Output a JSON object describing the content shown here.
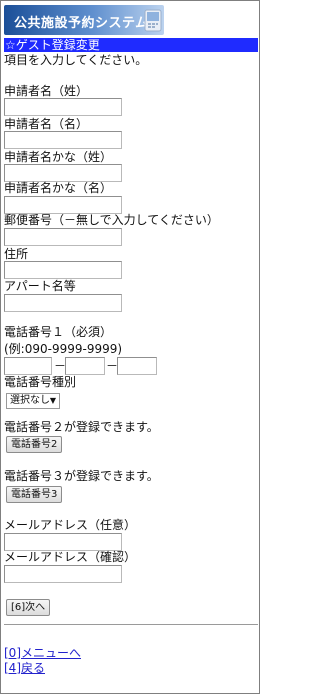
{
  "header": {
    "title": "公共施設予約システム"
  },
  "page_title": "☆ゲスト登録変更",
  "instruction": "項目を入力してください。",
  "fields": {
    "applicant_last": "申請者名（姓）",
    "applicant_first": "申請者名（名）",
    "applicant_kana_last": "申請者名かな（姓）",
    "applicant_kana_first": "申請者名かな（名）",
    "postal": "郵便番号（－無しで入力してください）",
    "address": "住所",
    "apartment": "アパート名等",
    "phone1": "電話番号１（必須）",
    "phone1_example": "(例:090-9999-9999)",
    "phone_separator": "－",
    "phone_type": "電話番号種別",
    "phone_type_value": "選択なし",
    "phone2_note": "電話番号２が登録できます。",
    "phone2_button": "電話番号2",
    "phone3_note": "電話番号３が登録できます。",
    "phone3_button": "電話番号3",
    "email_optional": "メールアドレス（任意）",
    "email_confirm": "メールアドレス（確認）"
  },
  "next_button": "[6]次へ",
  "links": {
    "menu": "[0]メニューへ",
    "back": "[4]戻る"
  },
  "colors": {
    "title_bar": "#1f2bff",
    "link": "#2222cc"
  },
  "icons": {
    "logo": "phone-logo-icon",
    "select_caret": "caret-down-icon"
  }
}
